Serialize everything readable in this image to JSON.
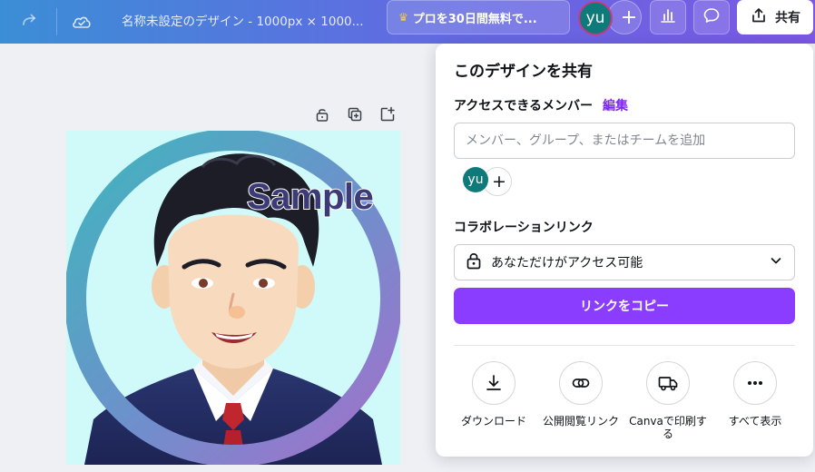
{
  "topbar": {
    "document_title": "名称未設定のデザイン - 1000px × 1000...",
    "pro_trial_label": "プロを30日間無料で...",
    "user_initials": "yu",
    "add_label": "+",
    "share_label": "共有",
    "icons": [
      "redo-icon",
      "cloud-saved-icon",
      "crown-icon",
      "insights-icon",
      "comment-icon",
      "share-upload-icon"
    ]
  },
  "canvas": {
    "toolbar_icons": [
      "lock-icon",
      "duplicate-icon",
      "add-page-icon"
    ],
    "watermark_text": "Sample"
  },
  "share_panel": {
    "title": "このデザインを共有",
    "access_members_label": "アクセスできるメンバー",
    "edit_link": "編集",
    "member_input_placeholder": "メンバー、グループ、またはチームを追加",
    "member_initials": "yu",
    "add_member_label": "+",
    "collab_link_label": "コラボレーションリンク",
    "access_select_value": "あなただけがアクセス可能",
    "copy_link_button": "リンクをコピー",
    "actions": [
      {
        "label": "ダウンロード",
        "icon": "download-icon"
      },
      {
        "label": "公開閲覧リンク",
        "icon": "link-icon"
      },
      {
        "label": "Canvaで印刷する",
        "icon": "print-truck-icon"
      },
      {
        "label": "すべて表示",
        "icon": "more-icon"
      }
    ]
  },
  "colors": {
    "accent_purple": "#8b3dff",
    "edit_link_purple": "#7d2ae8",
    "avatar_teal": "#0e7b7a",
    "topbar_gradient_start": "#3b8ed6",
    "topbar_gradient_end": "#7b57e4",
    "design_background": "#d0fafa"
  }
}
